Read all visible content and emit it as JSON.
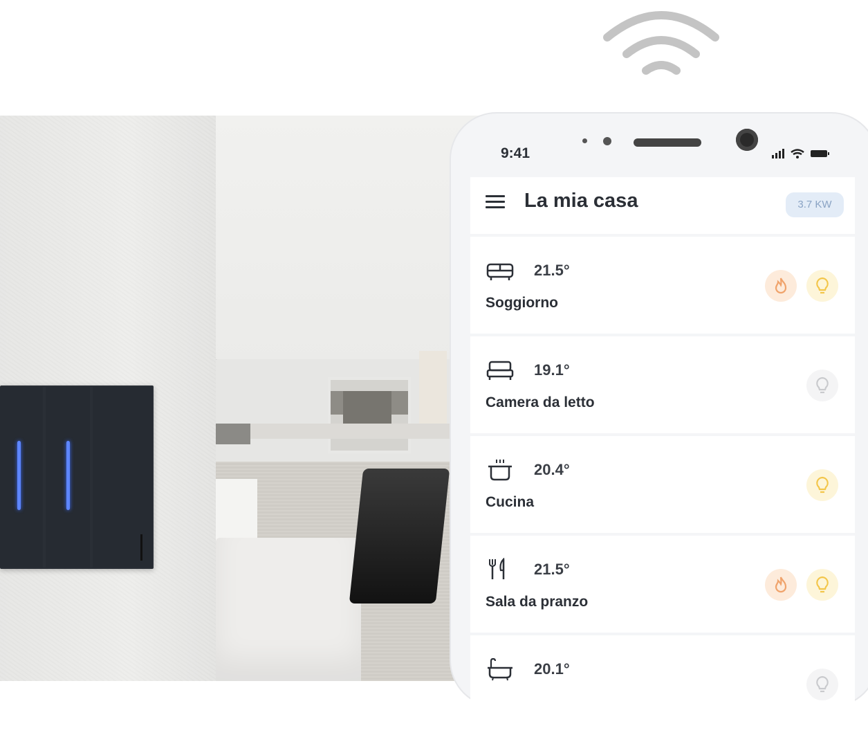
{
  "app": {
    "title": "La mia casa",
    "power_badge": "3.7 KW"
  },
  "status_bar": {
    "time": "9:41"
  },
  "rooms": [
    {
      "name": "Soggiorno",
      "temperature": "21.5°",
      "icon": "sofa-icon",
      "heating_on": true,
      "light": "on"
    },
    {
      "name": "Camera da letto",
      "temperature": "19.1°",
      "icon": "bed-icon",
      "heating_on": false,
      "light": "off"
    },
    {
      "name": "Cucina",
      "temperature": "20.4°",
      "icon": "cooking-pot-icon",
      "heating_on": false,
      "light": "on"
    },
    {
      "name": "Sala da pranzo",
      "temperature": "21.5°",
      "icon": "fork-knife-icon",
      "heating_on": true,
      "light": "on"
    },
    {
      "name": "",
      "temperature": "20.1°",
      "icon": "bathtub-icon",
      "heating_on": false,
      "light": "off"
    }
  ],
  "colors": {
    "heating_accent": "#f0a36b",
    "light_accent": "#f3c64a",
    "badge_bg": "#e3ecf7",
    "text": "#2b2f36"
  }
}
